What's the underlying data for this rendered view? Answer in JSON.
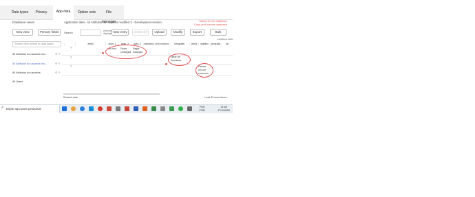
{
  "tabs": [
    {
      "label": "Data types",
      "active": false
    },
    {
      "label": "Privacy",
      "active": false
    },
    {
      "label": "App data",
      "active": true
    },
    {
      "label": "Option sets",
      "active": false
    },
    {
      "label": "File manager",
      "active": false
    }
  ],
  "sidebar": {
    "title": "Database views",
    "new_view": "New view",
    "primary_fields": "Primary fields",
    "search_placeholder": "Search view names or data types...",
    "items": [
      {
        "label": "All Atributos do usuarios mo...",
        "active": false
      },
      {
        "label": "All Atributos do usuarios mo...",
        "active": true
      },
      {
        "label": "All Atributos do usuarios",
        "active": false
      },
      {
        "label": "All Users",
        "active": false
      }
    ]
  },
  "main": {
    "title": "Application data - All Atributos do usuarios modified 2 - Development version",
    "link_switch": "Switch to live database",
    "link_copy": "Copy and restore database",
    "search_label": "Search",
    "search_value": "",
    "note_line1": "(Services",
    "note_line2": "displaying 3)",
    "buttons": {
      "new_entry": "New entry",
      "delete": "Delete (0)",
      "upload": "Upload",
      "modify": "Modify",
      "export": "Export",
      "bulk": "Bulk"
    },
    "additional_fields": "3 additional fields",
    "columns": [
      "",
      "",
      "email",
      "acao_1",
      "acao_2",
      "acao_3",
      "checkbox_com compromi",
      "fotografia",
      "check",
      "objetivo",
      "pergunta",
      "pe"
    ],
    "rows": [
      {
        "acao_1": "Ler livro",
        "acao_2": "Fazer",
        "acao_2b": "conseguir",
        "acao_3": "Pagar",
        "acao_3b": "inscrição",
        "fotografia": "",
        "fotografia_b": "",
        "objetivo": "",
        "objetivo_b": "",
        "objetivo_c": ""
      },
      {
        "acao_1": "",
        "acao_2": "",
        "acao_2b": "",
        "acao_3": "",
        "acao_3b": "",
        "fotografia": "Teste de",
        "fotografia_b": "formatura",
        "objetivo": "",
        "objetivo_b": "",
        "objetivo_c": ""
      },
      {
        "acao_1": "",
        "acao_2": "",
        "acao_2b": "",
        "acao_3": "",
        "acao_3b": "",
        "fotografia": "",
        "fotografia_b": "",
        "objetivo": "Passar",
        "objetivo_b": "em um",
        "objetivo_c": "concurso"
      }
    ],
    "footer_left": "Refresh data",
    "footer_right": "Load 50 more items..."
  },
  "taskbar": {
    "search_text": "Digite aqui para pesquisar",
    "lang": "POR",
    "lang2": "PTB2",
    "time": "21:46",
    "date": "17/11/2020"
  },
  "colors": {
    "annotation": "#e05050",
    "link": "#e35757",
    "active_item": "#4d6bc8"
  }
}
